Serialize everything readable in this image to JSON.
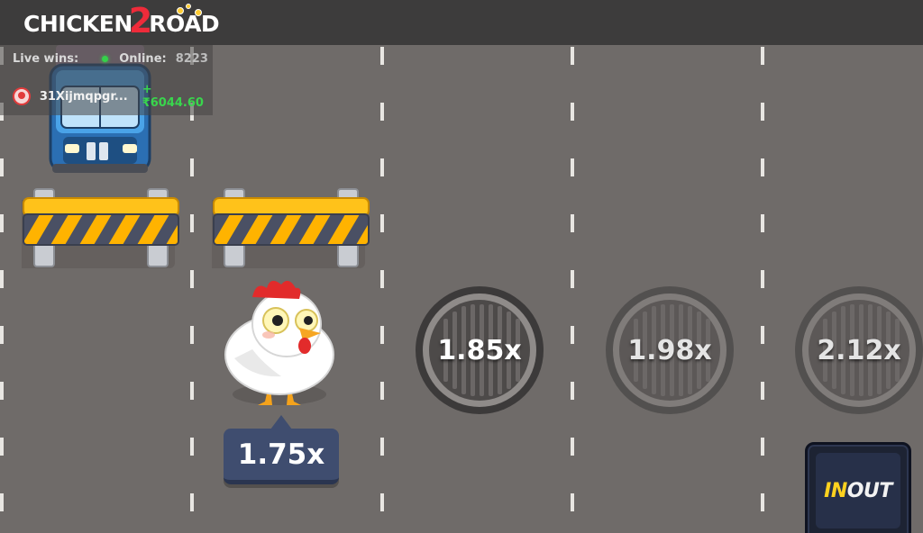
{
  "header": {
    "logo": {
      "text_left": "CHICKEN",
      "text_number": "2",
      "text_right": "ROAD"
    }
  },
  "live_panel": {
    "live_wins_label": "Live wins:",
    "online_label": "Online:",
    "online_count": "8223",
    "latest_win": {
      "user": "31Xijmqpgr...",
      "amount": "+₹6044.60"
    }
  },
  "game": {
    "current_multiplier": "1.75x",
    "next_multipliers": [
      "1.85x",
      "1.98x",
      "2.12x"
    ]
  },
  "provider_badge": {
    "brand_in": "IN",
    "brand_out": "OUT"
  },
  "colors": {
    "road": "#6f6b69",
    "header_bg": "#3d3c3c",
    "accent_red": "#ee2b3a",
    "win_green": "#39d64d",
    "multiplier_box": "#3f4d6f"
  },
  "icons": {
    "online_status": "green-dot-icon",
    "avatar": "user-avatar-icon",
    "chicken": "chicken-character-icon",
    "truck": "truck-icon",
    "barrier": "road-barrier-icon",
    "manhole": "manhole-icon"
  }
}
